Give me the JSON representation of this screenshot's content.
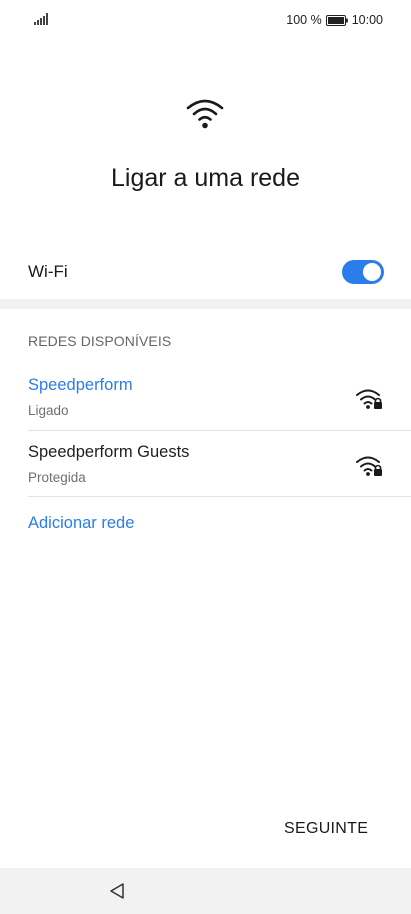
{
  "status_bar": {
    "battery_percent": "100 %",
    "time": "10:00",
    "signal_icon": "signal-icon",
    "battery_icon": "battery-icon"
  },
  "header": {
    "icon": "wifi-icon",
    "title": "Ligar a uma rede"
  },
  "wifi_toggle": {
    "label": "Wi-Fi",
    "on": true
  },
  "networks_section": {
    "header": "REDES DISPONÍVEIS",
    "items": [
      {
        "name": "Speedperform",
        "status": "Ligado",
        "connected": true,
        "icon": "wifi-lock-icon"
      },
      {
        "name": "Speedperform Guests",
        "status": "Protegida",
        "connected": false,
        "icon": "wifi-lock-icon"
      }
    ],
    "add_label": "Adicionar rede"
  },
  "footer": {
    "next_label": "SEGUINTE"
  },
  "nav_bar": {
    "back_icon": "back-icon"
  },
  "colors": {
    "accent": "#2b7de9",
    "text": "#1a1a1a",
    "secondary_text": "#6f6f6f"
  }
}
